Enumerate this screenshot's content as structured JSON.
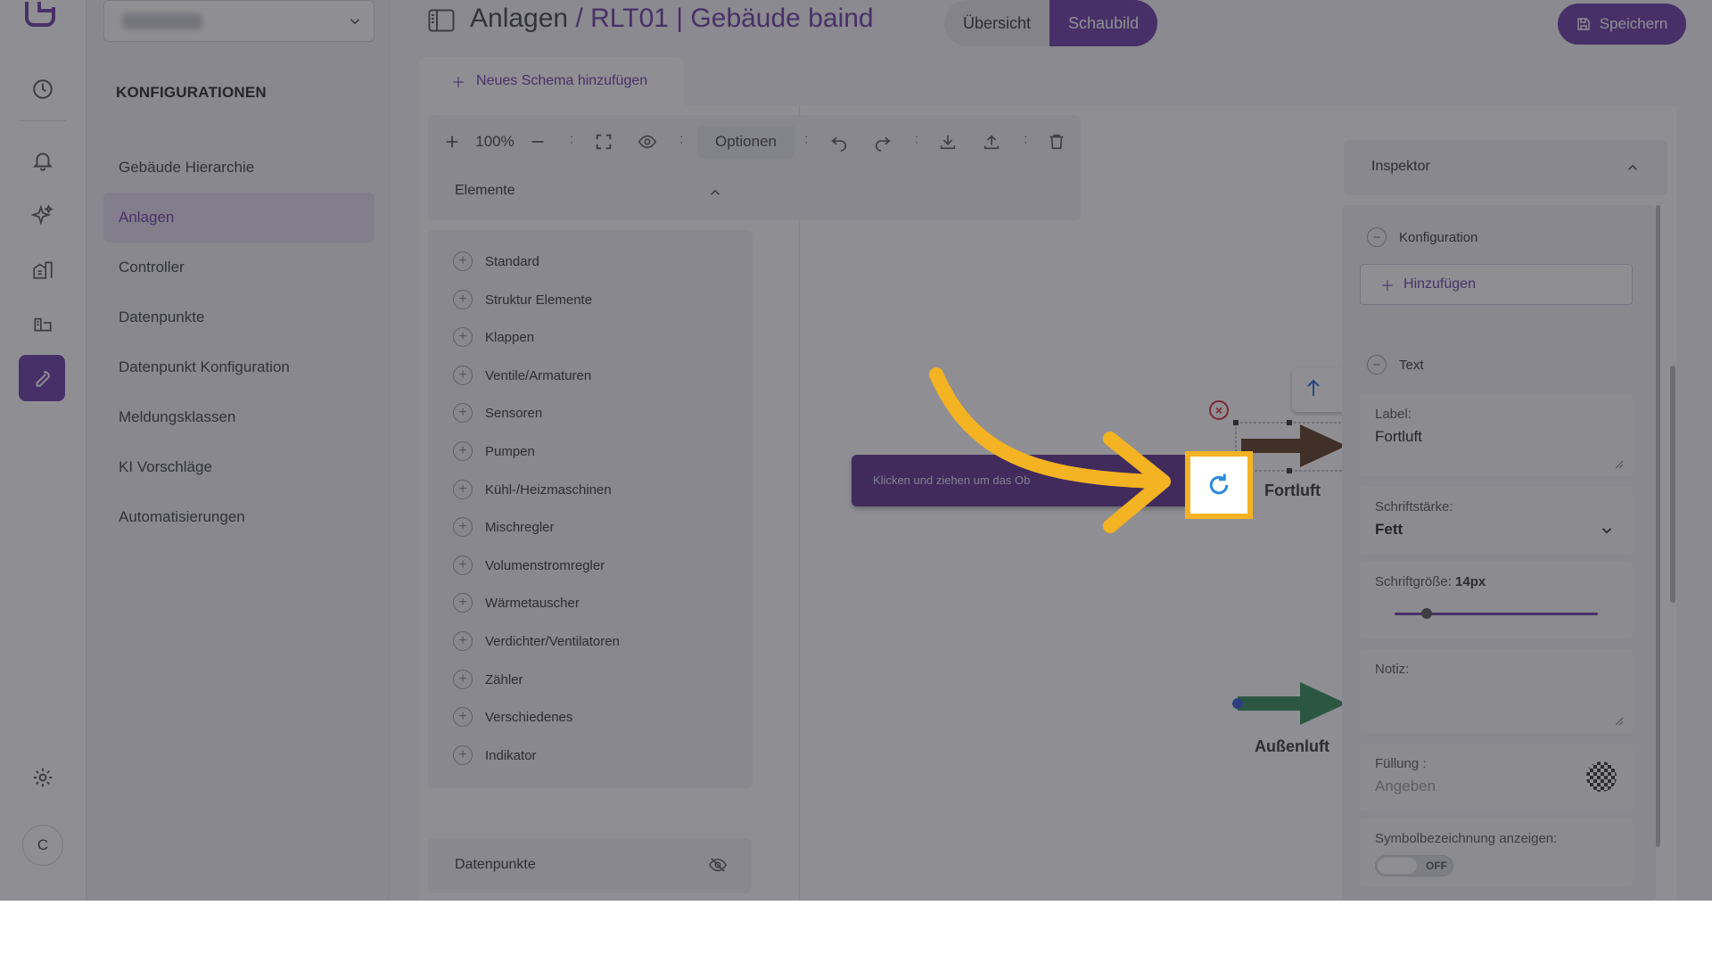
{
  "header": {
    "title_prefix": "Anlagen",
    "title_separator": "/",
    "title_sub": "RLT01 | Gebäude baind",
    "tabs": [
      "Übersicht",
      "Schaubild"
    ],
    "active_tab": "Schaubild",
    "save_label": "Speichern"
  },
  "sidebar": {
    "heading": "KONFIGURATIONEN",
    "items": [
      {
        "label": "Gebäude Hierarchie"
      },
      {
        "label": "Anlagen"
      },
      {
        "label": "Controller"
      },
      {
        "label": "Datenpunkte"
      },
      {
        "label": "Datenpunkt Konfiguration"
      },
      {
        "label": "Meldungsklassen"
      },
      {
        "label": "KI Vorschläge"
      },
      {
        "label": "Automatisierungen"
      }
    ],
    "active_item": "Anlagen"
  },
  "rail": {
    "icons": [
      "dashboard-icon",
      "bell-icon",
      "sparkles-icon",
      "buildings-icon",
      "devices-icon",
      "wrench-icon"
    ],
    "settings_icon": "gear-icon",
    "avatar_initial": "C"
  },
  "schema": {
    "add_label": "Neues Schema hinzufügen"
  },
  "toolbar": {
    "zoom": "100%",
    "separator": ":",
    "options_label": "Optionen"
  },
  "elements": {
    "title": "Elemente",
    "items": [
      "Standard",
      "Struktur Elemente",
      "Klappen",
      "Ventile/Armaturen",
      "Sensoren",
      "Pumpen",
      "Kühl-/Heizmaschinen",
      "Mischregler",
      "Volumenstromregler",
      "Wärmetauscher",
      "Verdichter/Ventilatoren",
      "Zähler",
      "Verschiedenes",
      "Indikator"
    ]
  },
  "datapoints": {
    "title": "Datenpunkte"
  },
  "canvas": {
    "tooltip": "Klicken und ziehen um das Ob",
    "label_fortluft": "Fortluft",
    "label_aussenluft": "Außenluft",
    "colors": {
      "fortluft_arrow": "#5b3a1e",
      "aussenluft_arrow": "#2e8b57",
      "highlight": "#f4b322",
      "accent": "#6a3aa3"
    }
  },
  "inspector": {
    "title": "Inspektor",
    "sections": {
      "config": "Konfiguration",
      "add_label": "Hinzufügen",
      "text": "Text"
    },
    "fields": {
      "label_label": "Label:",
      "label_value": "Fortluft",
      "weight_label": "Schriftstärke:",
      "weight_value": "Fett",
      "size_label": "Schriftgröße:",
      "size_value": "14px",
      "size_slider_fraction": 0.16,
      "note_label": "Notiz:",
      "fill_label": "Füllung :",
      "fill_placeholder": "Angeben",
      "symbol_label": "Symbolbezeichnung anzeigen:",
      "symbol_toggle": "OFF"
    }
  }
}
